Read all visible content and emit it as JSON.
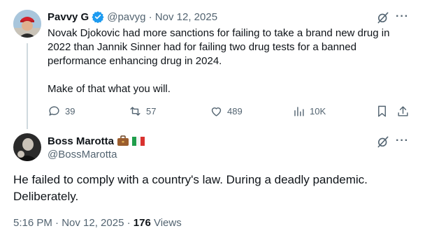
{
  "original_tweet": {
    "author_name": "Pavvy G",
    "handle_date": "@pavyg · Nov 12, 2025",
    "text": "Novak Djokovic had more sanctions for failing to take a brand new drug in\n2022 than Jannik Sinner had for failing two drug tests for a banned\nperformance enhancing drug in 2024.\n\nMake of that what you will.",
    "replies": "39",
    "reposts": "57",
    "likes": "489",
    "views": "10K",
    "verified_color": "#1d9bf0",
    "like_icon": "heart-icon",
    "repost_icon": "repost-icon"
  },
  "reply_tweet": {
    "author_name": "Boss Marotta",
    "handle": "@BossMarotta",
    "text": "He failed to comply with a country's law. During a deadly pandemic.\nDeliberately.",
    "time_date": "5:16 PM · Nov 12, 2025 · ",
    "views_count": "176",
    "views_label": " Views",
    "badges": [
      "briefcase-emoji",
      "italy-flag"
    ]
  },
  "more_glyph": "···"
}
